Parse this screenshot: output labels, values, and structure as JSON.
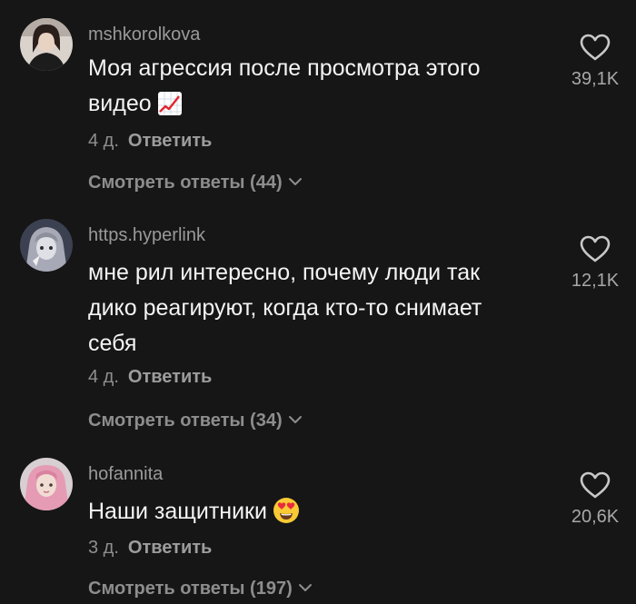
{
  "comments": [
    {
      "username": "mshkorolkova",
      "text": "Моя агрессия после просмотра этого видео",
      "text_emoji": "chart-increasing-emoji",
      "time": "4 д.",
      "reply_label": "Ответить",
      "view_replies": "Смотреть ответы (44)",
      "likes": "39,1K"
    },
    {
      "username": "https.hyperlink",
      "text": "мне рил интересно, почему люди так дико реагируют, когда кто-то снимает себя",
      "time": "4 д.",
      "reply_label": "Ответить",
      "view_replies": "Смотреть ответы (34)",
      "likes": "12,1K"
    },
    {
      "username": "hofannita",
      "text": "Наши защитники",
      "text_emoji": "heart-eyes-emoji",
      "time": "3 д.",
      "reply_label": "Ответить",
      "view_replies": "Смотреть ответы (197)",
      "likes": "20,6K"
    }
  ],
  "icons": {
    "like": "heart-outline-icon",
    "expand": "chevron-down-icon"
  },
  "colors": {
    "background": "#161616",
    "text": "#f4f4f4",
    "secondary": "#8f8f8f"
  }
}
